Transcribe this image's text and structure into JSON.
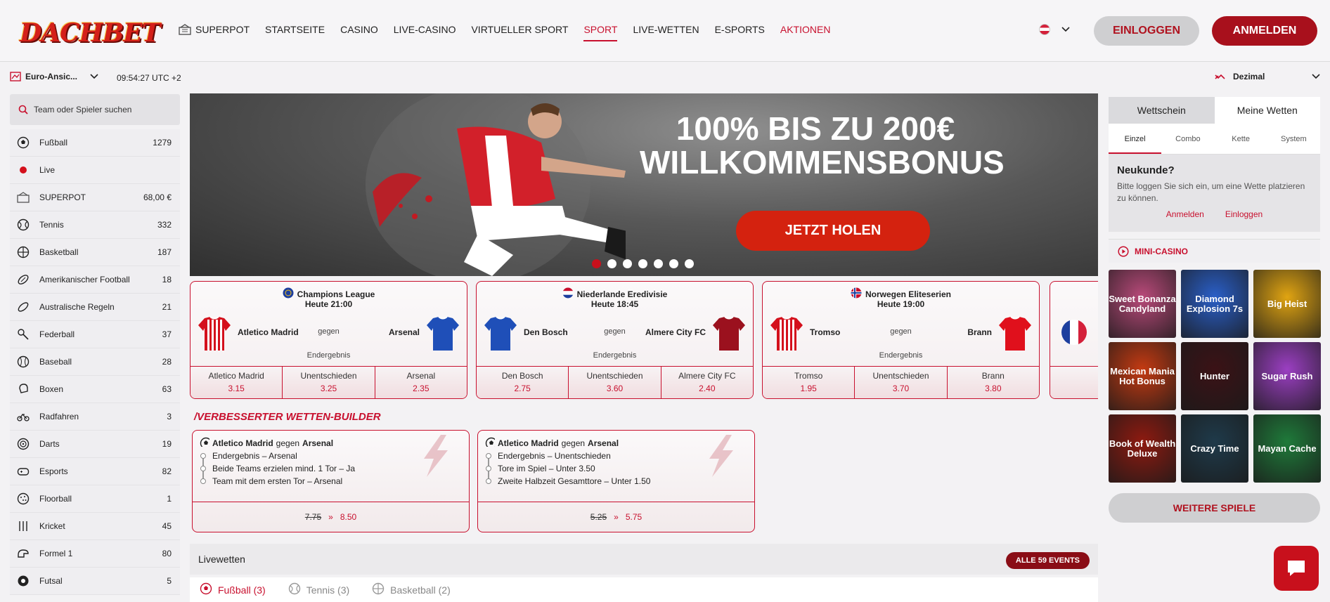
{
  "header": {
    "logo": "DACHBET",
    "nav": [
      {
        "label": "SUPERPOT",
        "icon": "superpot-icon"
      },
      {
        "label": "STARTSEITE"
      },
      {
        "label": "CASINO"
      },
      {
        "label": "LIVE-CASINO"
      },
      {
        "label": "VIRTUELLER SPORT"
      },
      {
        "label": "SPORT",
        "active": true
      },
      {
        "label": "LIVE-WETTEN"
      },
      {
        "label": "E-SPORTS"
      },
      {
        "label": "AKTIONEN",
        "promo": true
      }
    ],
    "login_label": "EINLOGGEN",
    "register_label": "ANMELDEN"
  },
  "subheader": {
    "odds_view": "Euro-Ansic...",
    "time": "09:54:27 UTC +2",
    "odds_format": "Dezimal"
  },
  "sidebar": {
    "search_placeholder": "Team oder Spieler suchen",
    "sports": [
      {
        "label": "Fußball",
        "count": "1279",
        "icon": "football-icon"
      },
      {
        "label": "Live",
        "count": "",
        "icon": "live-dot-icon"
      },
      {
        "label": "SUPERPOT",
        "count": "68,00 €",
        "icon": "superpot-icon"
      },
      {
        "label": "Tennis",
        "count": "332",
        "icon": "tennis-icon"
      },
      {
        "label": "Basketball",
        "count": "187",
        "icon": "basketball-icon"
      },
      {
        "label": "Amerikanischer Football",
        "count": "18",
        "icon": "american-football-icon"
      },
      {
        "label": "Australische Regeln",
        "count": "21",
        "icon": "aussie-rules-icon"
      },
      {
        "label": "Federball",
        "count": "37",
        "icon": "badminton-icon"
      },
      {
        "label": "Baseball",
        "count": "28",
        "icon": "baseball-icon"
      },
      {
        "label": "Boxen",
        "count": "63",
        "icon": "boxing-icon"
      },
      {
        "label": "Radfahren",
        "count": "3",
        "icon": "cycling-icon"
      },
      {
        "label": "Darts",
        "count": "19",
        "icon": "darts-icon"
      },
      {
        "label": "Esports",
        "count": "82",
        "icon": "esports-icon"
      },
      {
        "label": "Floorball",
        "count": "1",
        "icon": "floorball-icon"
      },
      {
        "label": "Kricket",
        "count": "45",
        "icon": "cricket-icon"
      },
      {
        "label": "Formel 1",
        "count": "80",
        "icon": "formula1-icon"
      },
      {
        "label": "Futsal",
        "count": "5",
        "icon": "futsal-icon"
      }
    ]
  },
  "banner": {
    "headline1": "100% BIS ZU 200€",
    "headline2": "WILLKOMMENSBONUS",
    "cta": "JETZT HOLEN",
    "slides": 7,
    "active_slide": 0
  },
  "matches": [
    {
      "league": "Champions League",
      "time": "Heute 21:00",
      "home": "Atletico Madrid",
      "away": "Arsenal",
      "vs": "gegen",
      "market": "Endergebnis",
      "odds": [
        {
          "label": "Atletico Madrid",
          "value": "3.15"
        },
        {
          "label": "Unentschieden",
          "value": "3.25"
        },
        {
          "label": "Arsenal",
          "value": "2.35"
        }
      ],
      "home_color": "#d4101c",
      "away_color": "#1f4fb8"
    },
    {
      "league": "Niederlande Eredivisie",
      "time": "Heute 18:45",
      "home": "Den Bosch",
      "away": "Almere City FC",
      "vs": "gegen",
      "market": "Endergebnis",
      "odds": [
        {
          "label": "Den Bosch",
          "value": "2.75"
        },
        {
          "label": "Unentschieden",
          "value": "3.60"
        },
        {
          "label": "Almere City FC",
          "value": "2.40"
        }
      ],
      "home_color": "#1f4fb8",
      "away_color": "#9b111e"
    },
    {
      "league": "Norwegen Eliteserien",
      "time": "Heute 19:00",
      "home": "Tromso",
      "away": "Brann",
      "vs": "gegen",
      "market": "Endergebnis",
      "odds": [
        {
          "label": "Tromso",
          "value": "1.95"
        },
        {
          "label": "Unentschieden",
          "value": "3.70"
        },
        {
          "label": "Brann",
          "value": "3.80"
        }
      ],
      "home_color": "#d4101c",
      "away_color": "#e0101c"
    }
  ],
  "bet_builder": {
    "title": "VERBESSERTER WETTEN-BUILDER",
    "cards": [
      {
        "home": "Atletico Madrid",
        "vs": "gegen",
        "away": "Arsenal",
        "selections": [
          "Endergebnis – Arsenal",
          "Beide Teams erzielen mind. 1 Tor – Ja",
          "Team mit dem ersten Tor – Arsenal"
        ],
        "old_odds": "7.75",
        "new_odds": "8.50"
      },
      {
        "home": "Atletico Madrid",
        "vs": "gegen",
        "away": "Arsenal",
        "selections": [
          "Endergebnis – Unentschieden",
          "Tore im Spiel – Unter 3.50",
          "Zweite Halbzeit Gesamttore – Unter 1.50"
        ],
        "old_odds": "5.25",
        "new_odds": "5.75"
      }
    ]
  },
  "live": {
    "title": "Livewetten",
    "all_events": "ALLE 59 EVENTS",
    "tabs": [
      {
        "label": "Fußball (3)",
        "icon": "football-icon",
        "active": true
      },
      {
        "label": "Tennis (3)",
        "icon": "tennis-icon"
      },
      {
        "label": "Basketball (2)",
        "icon": "basketball-icon"
      }
    ]
  },
  "betslip": {
    "tabs": [
      "Wettschein",
      "Meine Wetten"
    ],
    "subtabs": [
      "Einzel",
      "Combo",
      "Kette",
      "System"
    ],
    "heading": "Neukunde?",
    "text": "Bitte loggen Sie sich ein, um eine Wette platzieren zu können.",
    "register_link": "Anmelden",
    "login_link": "Einloggen"
  },
  "casino": {
    "title": "MINI-CASINO",
    "games": [
      {
        "name": "Sweet Bonanza Candyland",
        "bg": "#b94a7a"
      },
      {
        "name": "Diamond Explosion 7s",
        "bg": "#2a5fc8"
      },
      {
        "name": "Big Heist",
        "bg": "#e0a412"
      },
      {
        "name": "Mexican Mania Hot Bonus",
        "bg": "#c43a12"
      },
      {
        "name": "Hunter",
        "bg": "#3b1216"
      },
      {
        "name": "Sugar Rush",
        "bg": "#9b3fc2"
      },
      {
        "name": "Book of Wealth Deluxe",
        "bg": "#8e1a10"
      },
      {
        "name": "Crazy Time",
        "bg": "#1f3a4a"
      },
      {
        "name": "Mayan Cache",
        "bg": "#1f7a3a"
      }
    ],
    "more_label": "WEITERE SPIELE"
  },
  "colors": {
    "brand_red": "#c8102e",
    "dark_red": "#a8101c"
  }
}
